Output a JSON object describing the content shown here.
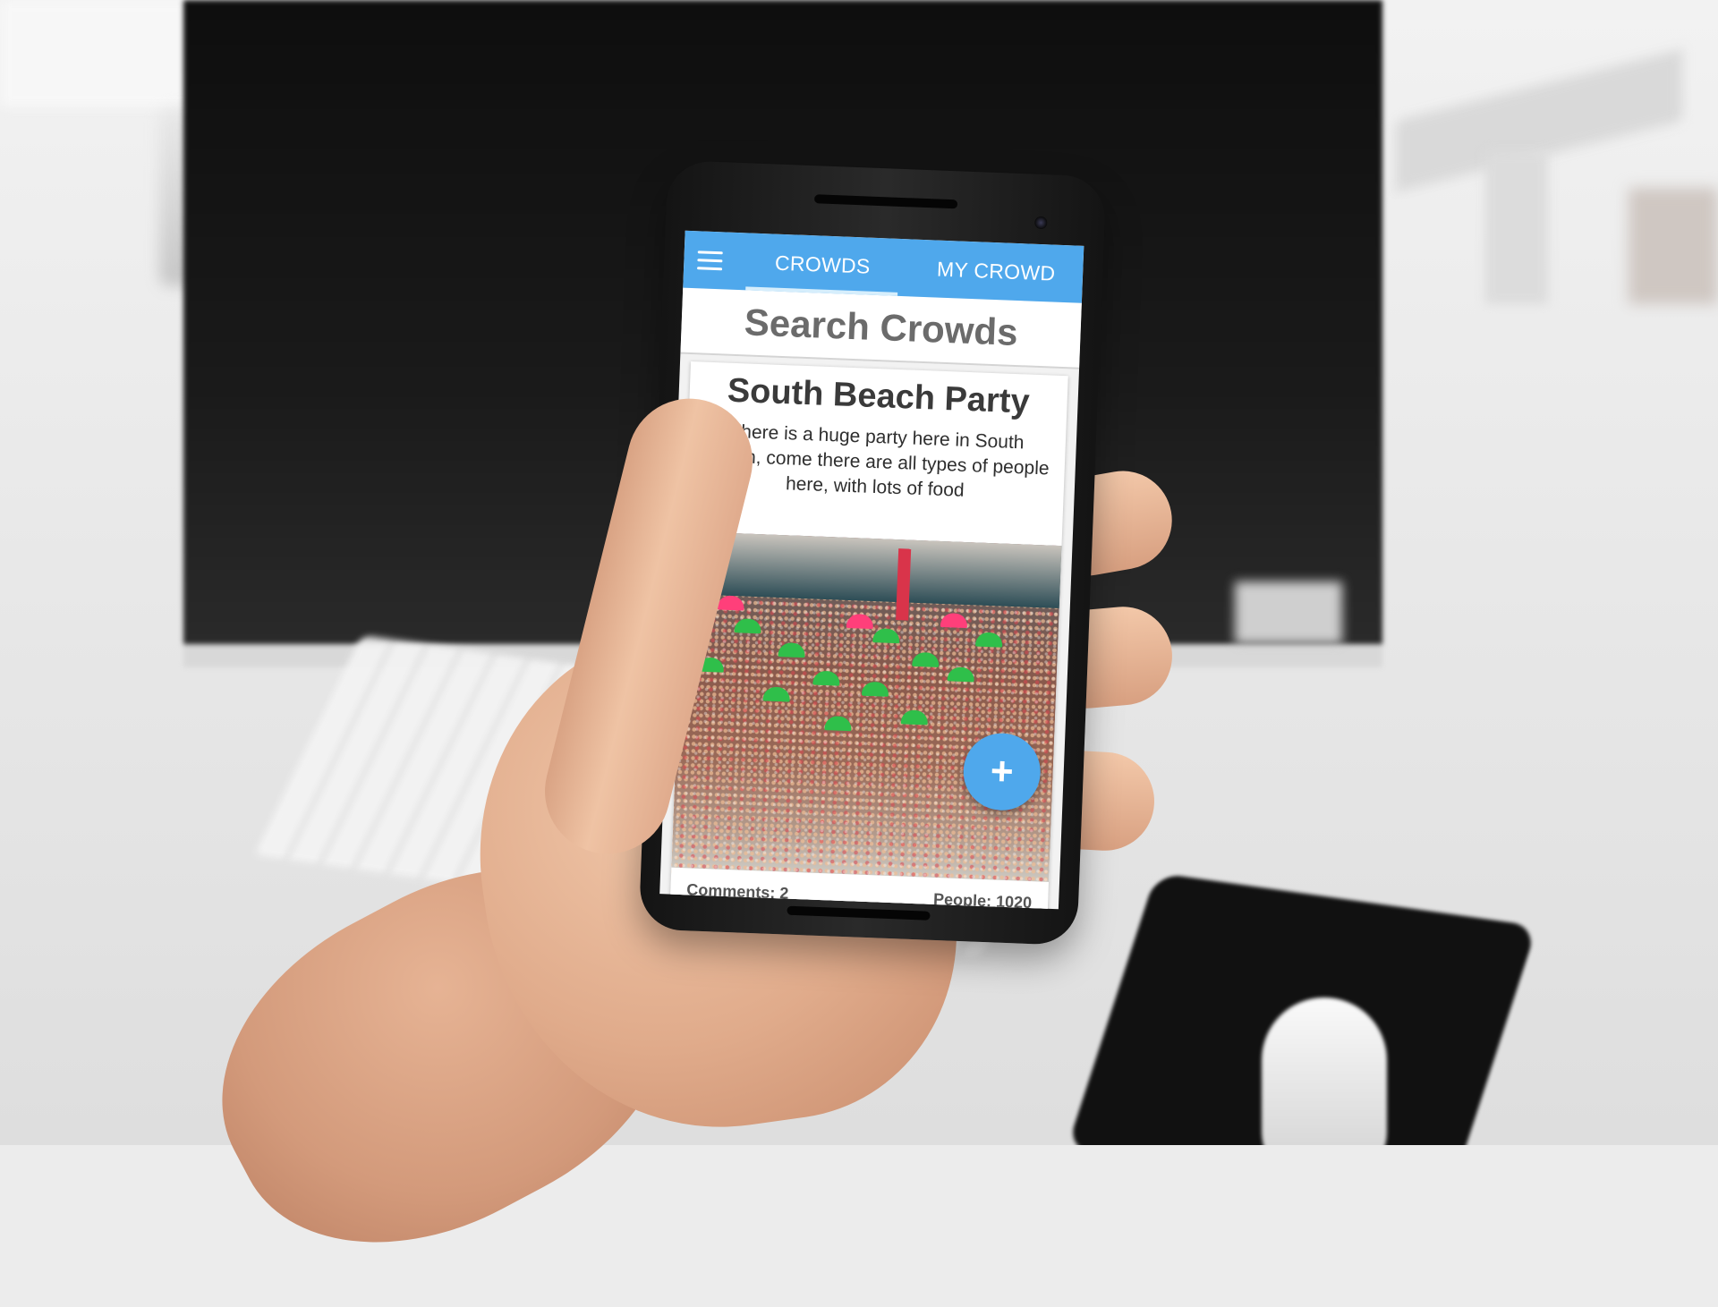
{
  "app": {
    "tabs": [
      {
        "label": "CROWDS",
        "active": true
      },
      {
        "label": "MY CROWD",
        "active": false
      }
    ],
    "accent_color": "#4fa8ec"
  },
  "search": {
    "title": "Search Crowds"
  },
  "crowd_card": {
    "title": "South Beach Party",
    "description": "There is a huge party here in South Beach, come there are all types of people here, with lots of food",
    "comments_label": "Comments: 2",
    "people_label": "People: 1020"
  },
  "fab": {
    "icon": "plus-icon",
    "glyph": "+"
  },
  "icons": {
    "menu": "hamburger-menu-icon"
  }
}
